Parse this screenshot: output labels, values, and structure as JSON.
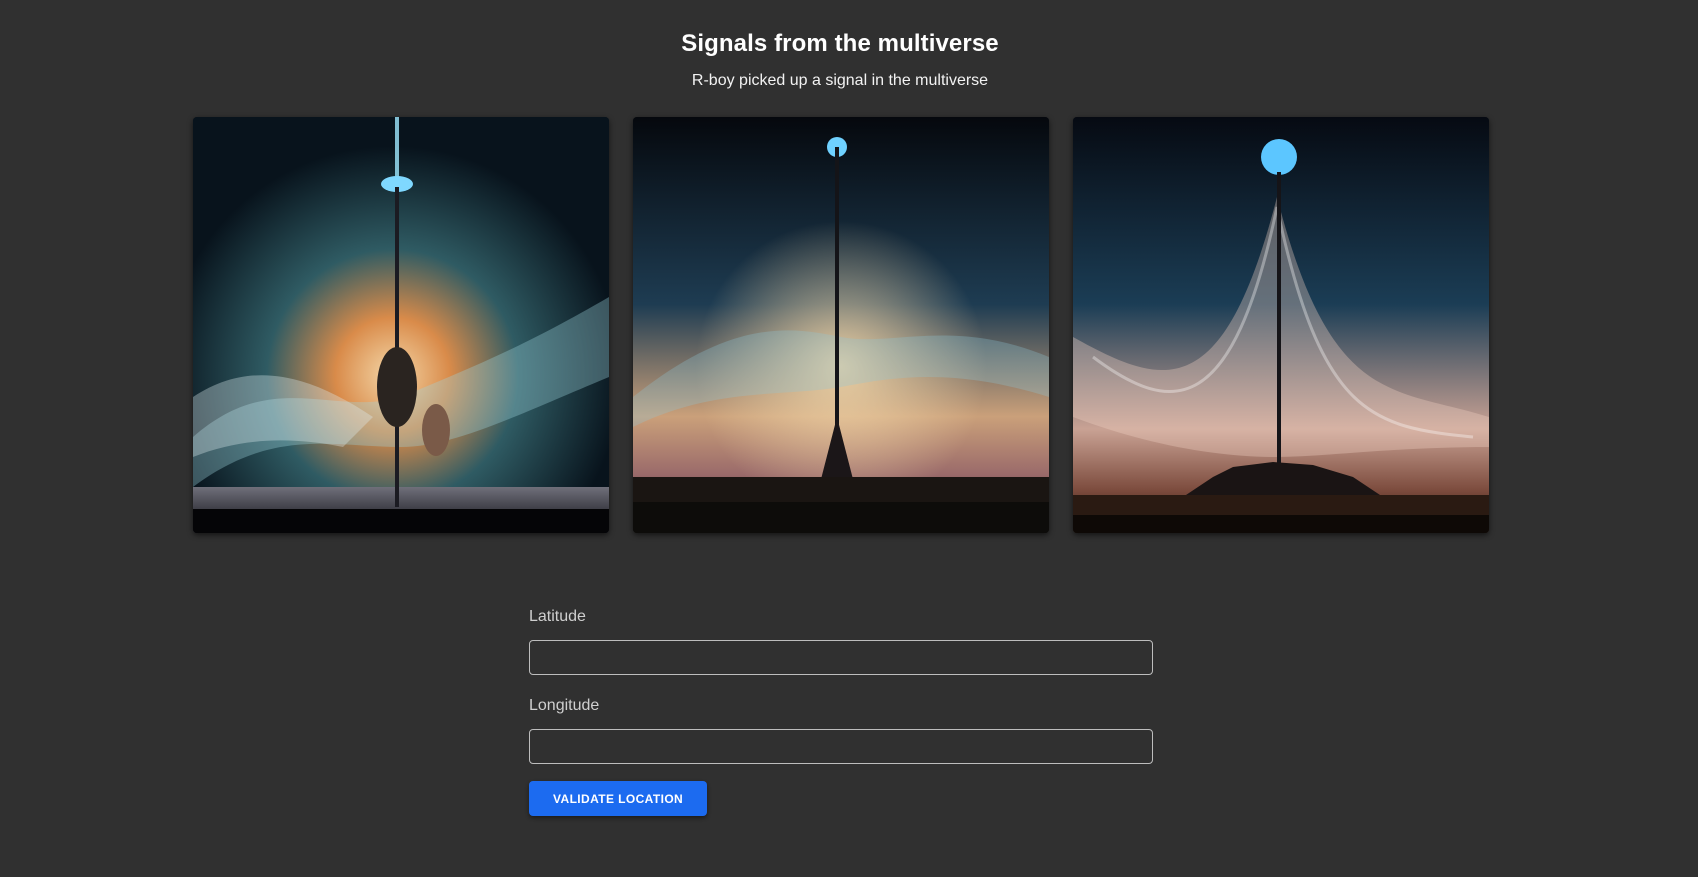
{
  "header": {
    "title": "Signals from the multiverse",
    "subtitle": "R-boy picked up a signal in the multiverse"
  },
  "images": [
    {
      "name": "signal-tower-image-1"
    },
    {
      "name": "signal-tower-image-2"
    },
    {
      "name": "signal-tower-image-3"
    }
  ],
  "form": {
    "latitude_label": "Latitude",
    "latitude_value": "",
    "longitude_label": "Longitude",
    "longitude_value": "",
    "submit_label": "VALIDATE LOCATION"
  },
  "colors": {
    "background": "#303030",
    "accent": "#1c6bf0"
  }
}
